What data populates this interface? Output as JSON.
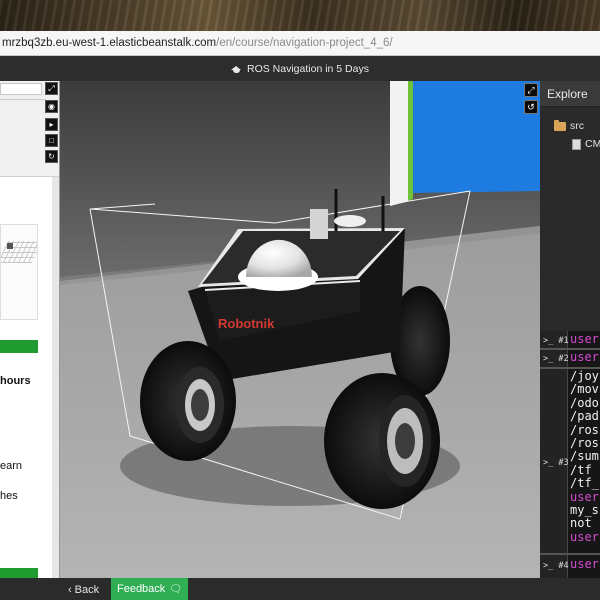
{
  "browser": {
    "url_host": "mrzbq3zb.eu-west-1.elasticbeanstalk.com",
    "url_path": "/en/course/navigation-project_4_6/"
  },
  "header": {
    "title": "ROS Navigation in 5 Days",
    "icon": "graduation-cap-icon"
  },
  "left_panel": {
    "fragments": [
      "hours",
      "earn",
      "hes"
    ]
  },
  "viewport": {
    "robot_brand": "Robotnik",
    "controls": [
      "expand-icon",
      "reset-view-icon"
    ],
    "side_controls": [
      "expand-icon",
      "eye-icon",
      "play-icon",
      "stop-icon",
      "refresh-icon"
    ]
  },
  "explorer": {
    "title": "Explore",
    "items": [
      {
        "label": "src",
        "icon": "folder-icon"
      },
      {
        "label": "CM",
        "icon": "file-icon"
      }
    ]
  },
  "terminals": {
    "shells": [
      {
        "label": ">_ #1",
        "lines": [
          "user"
        ]
      },
      {
        "label": ">_ #2",
        "lines": [
          "user"
        ]
      },
      {
        "label": ">_ #3",
        "lines": [
          "/joy",
          "/mov",
          "/odo",
          "/pad",
          "/ros",
          "/ros",
          "/sum",
          "/tf",
          "/tf_",
          "user",
          "my_s",
          "not",
          "user"
        ]
      },
      {
        "label": ">_ #4",
        "lines": [
          "user"
        ]
      }
    ]
  },
  "footer": {
    "back_label": "Back",
    "feedback_label": "Feedback"
  },
  "colors": {
    "accent_green": "#2fae54",
    "prompt_magenta": "#d44ad4",
    "sky_blue": "#1e7be0"
  }
}
